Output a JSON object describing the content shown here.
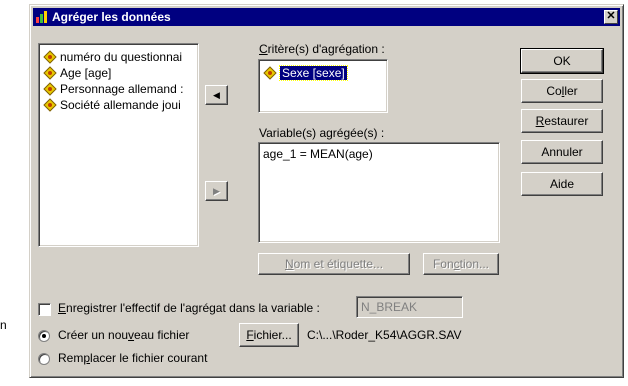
{
  "left_margin": {
    "fragment": "n"
  },
  "window": {
    "title": "Agréger les données",
    "close_glyph": "✕"
  },
  "source_list": {
    "items": [
      {
        "label": "numéro du questionnai",
        "icon": "variable-icon"
      },
      {
        "label": "Age [age]",
        "icon": "variable-icon"
      },
      {
        "label": "Personnage allemand :",
        "icon": "variable-icon"
      },
      {
        "label": "Société allemande joui",
        "icon": "variable-icon"
      }
    ]
  },
  "break_vars": {
    "label_mnemonic": "C",
    "label_rest": "ritère(s) d'agrégation :",
    "items": [
      {
        "label": "Sexe [sexe]",
        "selected": true
      }
    ]
  },
  "aggregated_vars": {
    "label": "Variable(s) agrégée(s) :",
    "items": [
      {
        "label": "age_1 = MEAN(age)"
      }
    ]
  },
  "transfer": {
    "left_glyph": "◀",
    "right_glyph": "▶"
  },
  "buttons": {
    "ok": "OK",
    "paste_pre": "Co",
    "paste_mn": "l",
    "paste_post": "ler",
    "reset_mn": "R",
    "reset_post": "estaurer",
    "cancel": "Annuler",
    "help": "Aide",
    "name_label_mn": "N",
    "name_label_post": "om et étiquette...",
    "function_pre": "Fon",
    "function_mn": "c",
    "function_post": "tion...",
    "file_mn": "F",
    "file_post": "ichier..."
  },
  "options": {
    "save_count_mn": "E",
    "save_count_post": "nregistrer l'effectif de l'agrégat dans la variable :",
    "save_count_checked": false,
    "count_var_value": "N_BREAK",
    "new_file_pre": "Créer un nou",
    "new_file_mn": "v",
    "new_file_post": "eau fichier",
    "new_file_selected": true,
    "file_path": "C:\\...\\Roder_K54\\AGGR.SAV",
    "replace_pre": "Rem",
    "replace_mn": "p",
    "replace_post": "lacer le fichier courant",
    "replace_selected": false
  },
  "colors": {
    "titlebar": "#000080",
    "dialog_face": "#d4d0c8",
    "selection": "#000080",
    "variable_icon": "#e8c800"
  }
}
